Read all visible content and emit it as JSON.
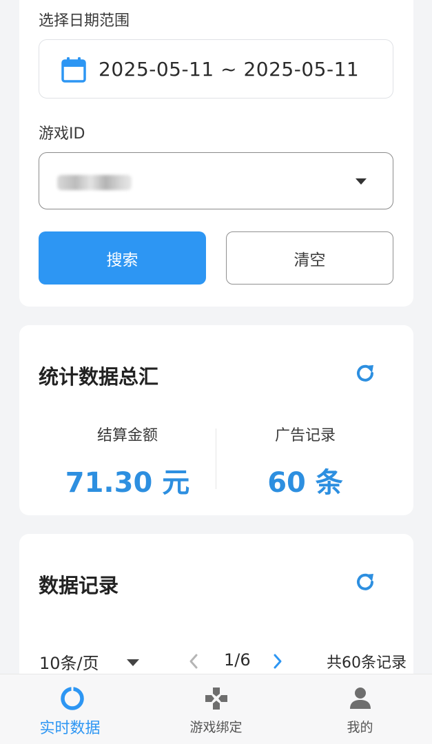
{
  "filter": {
    "date_label": "选择日期范围",
    "date_value": "2025-05-11 ~ 2025-05-11",
    "game_id_label": "游戏ID",
    "search_button": "搜索",
    "clear_button": "清空"
  },
  "stats": {
    "title": "统计数据总汇",
    "settlement_label": "结算金额",
    "settlement_value": "71.30 元",
    "ads_label": "广告记录",
    "ads_value": "60 条"
  },
  "records": {
    "title": "数据记录",
    "page_size": "10条/页",
    "page": "1/6",
    "total": "共60条记录"
  },
  "tabbar": {
    "tabs": [
      {
        "label": "实时数据",
        "icon": "realtime-ring-icon",
        "active": true
      },
      {
        "label": "游戏绑定",
        "icon": "gamepad-icon",
        "active": false
      },
      {
        "label": "我的",
        "icon": "user-icon",
        "active": false
      }
    ]
  },
  "colors": {
    "accent": "#2d96f3",
    "value_blue": "#2d8fe0",
    "background": "#f3f4f6"
  }
}
